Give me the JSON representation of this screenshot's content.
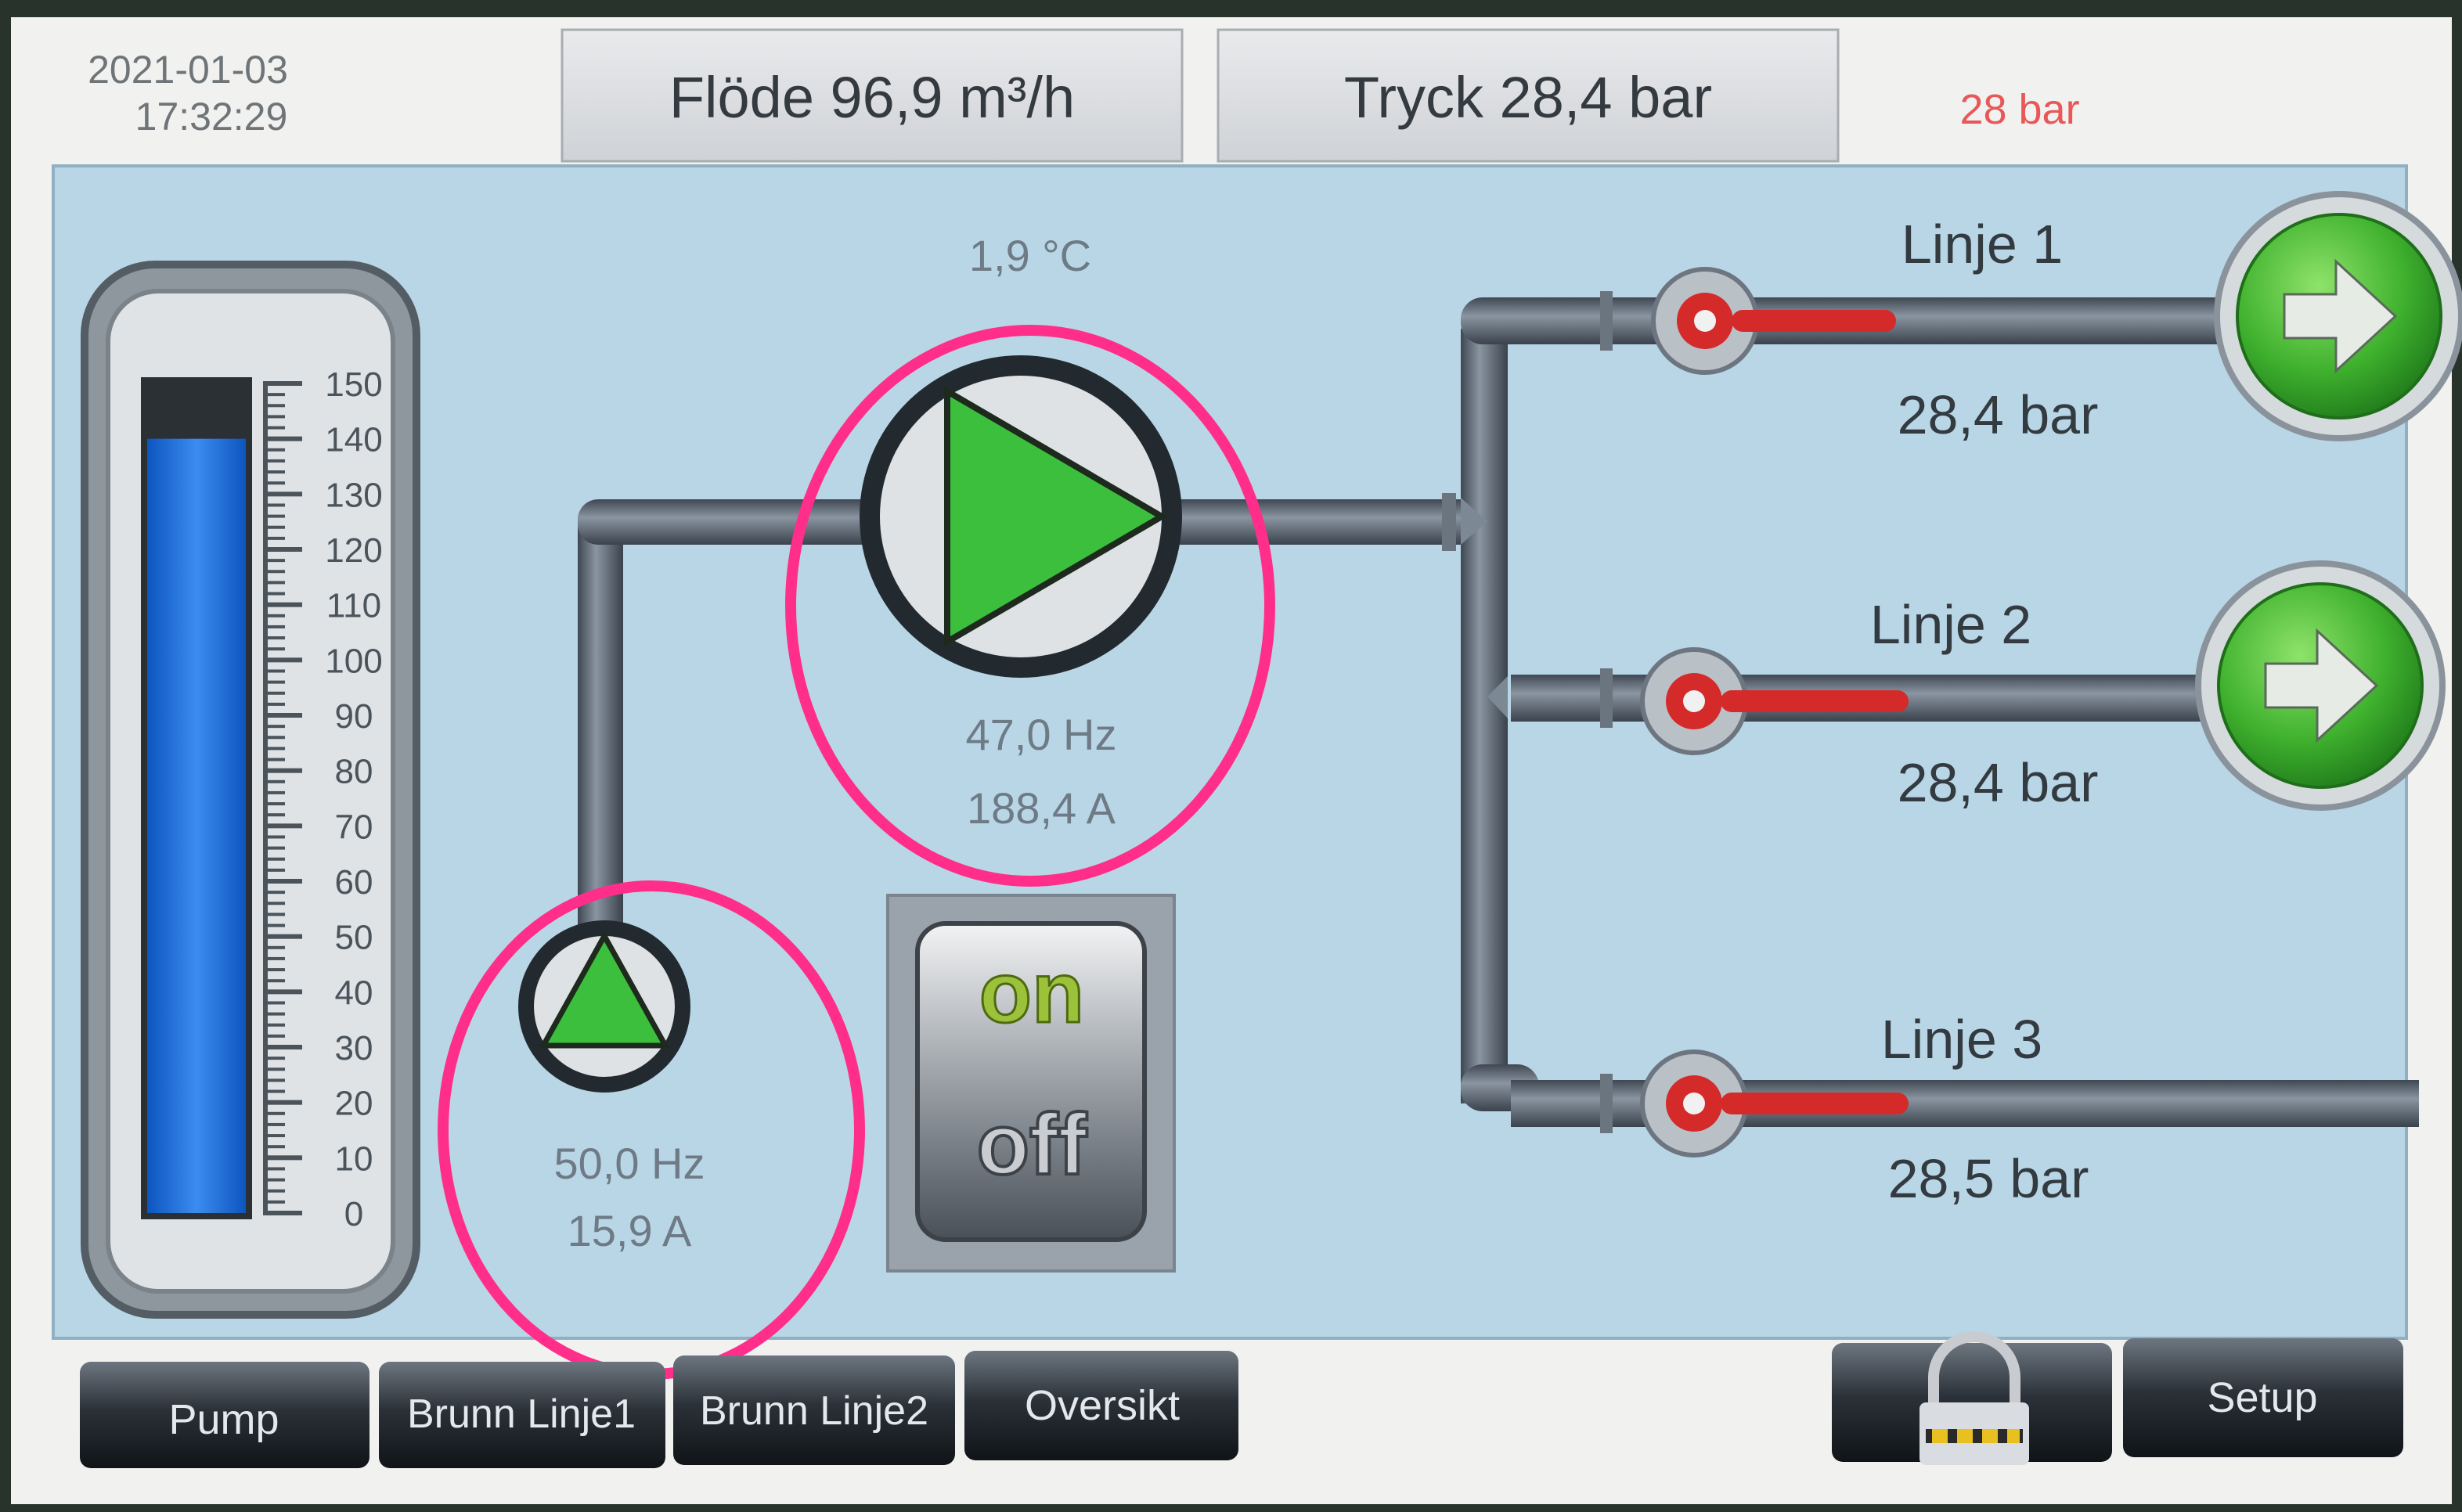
{
  "header": {
    "date": "2021-01-03",
    "time": "17:32:29",
    "flow": "Flöde 96,9 m³/h",
    "pressure": "Tryck 28,4 bar",
    "setpoint": "28 bar"
  },
  "tank": {
    "level_value": 140,
    "scale_max": 150,
    "scale_labels": [
      "150",
      "140",
      "130",
      "120",
      "110",
      "100",
      "90",
      "80",
      "70",
      "60",
      "50",
      "40",
      "30",
      "20",
      "10",
      "0"
    ]
  },
  "main_pump": {
    "temperature": "1,9 °C",
    "frequency": "47,0 Hz",
    "current": "188,4 A",
    "icon": "pump-play-icon"
  },
  "well_pump": {
    "frequency": "50,0 Hz",
    "current": "15,9 A",
    "icon": "pump-triangle-icon"
  },
  "switch": {
    "on_label": "on",
    "off_label": "off"
  },
  "lines": [
    {
      "label": "Linje 1",
      "pressure": "28,4 bar"
    },
    {
      "label": "Linje 2",
      "pressure": "28,4 bar"
    },
    {
      "label": "Linje 3",
      "pressure": "28,5 bar"
    }
  ],
  "nav": {
    "tabs": [
      "Pump",
      "Brunn Linje1",
      "Brunn Linje2",
      "Oversikt"
    ],
    "lock_icon": "lock-icon",
    "setup": "Setup"
  },
  "colors": {
    "panel_bg": "#b9d6e6",
    "pipe": "#5d6874",
    "pump_green": "#3cbf3c",
    "valve_red": "#d42a2a",
    "highlight_pink": "#ff2e8a",
    "setpoint_red": "#e85858",
    "water_blue": "#1b6fd6"
  }
}
